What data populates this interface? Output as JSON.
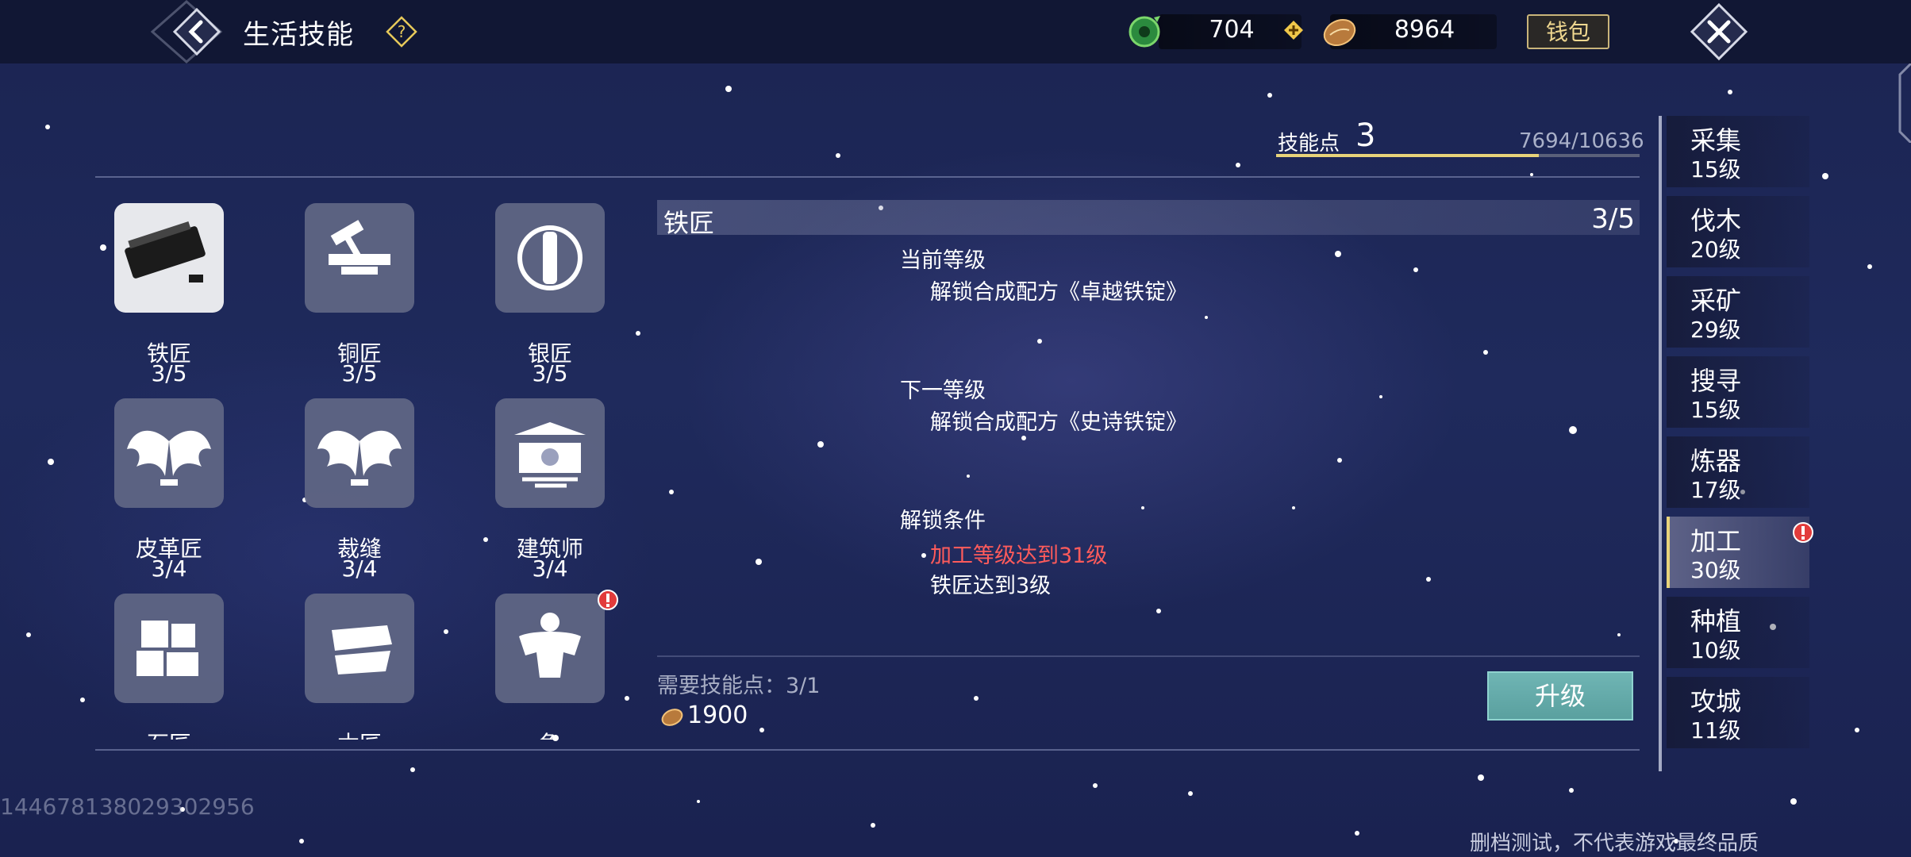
{
  "header": {
    "title": "生活技能",
    "help_icon": "question-diamond-icon",
    "resource1": {
      "icon": "jade-coin-icon",
      "value": "704"
    },
    "resource2": {
      "icon": "coin-pouch-icon",
      "value": "8964"
    },
    "wallet_label": "钱包"
  },
  "skill_points": {
    "label": "技能点",
    "value": "3",
    "progress_text": "7694/10636",
    "progress_fraction": 0.7234
  },
  "skills": [
    {
      "name": "铁匠",
      "level": "3/5",
      "icon": "iron-ingot-icon",
      "selected": true,
      "alert": false
    },
    {
      "name": "铜匠",
      "level": "3/5",
      "icon": "hammer-anvil-icon",
      "selected": false,
      "alert": false
    },
    {
      "name": "银匠",
      "level": "3/5",
      "icon": "silver-scroll-icon",
      "selected": false,
      "alert": false
    },
    {
      "name": "皮革匠",
      "level": "3/4",
      "icon": "wings-icon",
      "selected": false,
      "alert": false
    },
    {
      "name": "裁缝",
      "level": "3/4",
      "icon": "wings-icon",
      "selected": false,
      "alert": false
    },
    {
      "name": "建筑师",
      "level": "3/4",
      "icon": "pavilion-icon",
      "selected": false,
      "alert": false
    },
    {
      "name": "石匠",
      "level": "",
      "icon": "stone-blocks-icon",
      "selected": false,
      "alert": false
    },
    {
      "name": "木匠",
      "level": "",
      "icon": "wood-block-icon",
      "selected": false,
      "alert": false
    },
    {
      "name": "兔",
      "level": "",
      "icon": "muscle-figure-icon",
      "selected": false,
      "alert": true
    }
  ],
  "detail": {
    "title": "铁匠",
    "level": "3/5",
    "current_label": "当前等级",
    "current_text": "解锁合成配方《卓越铁锭》",
    "next_label": "下一等级",
    "next_text": "解锁合成配方《史诗铁锭》",
    "unlock_label": "解锁条件",
    "requirements": [
      {
        "text": "加工等级达到31级",
        "met": false
      },
      {
        "text": "铁匠达到3级",
        "met": true
      }
    ],
    "need_points_label": "需要技能点：3/1",
    "cost_icon": "coin-pouch-icon",
    "cost_value": "1900",
    "upgrade_label": "升级"
  },
  "tabs": [
    {
      "name": "采集",
      "level": "15级",
      "active": false,
      "alert": false
    },
    {
      "name": "伐木",
      "level": "20级",
      "active": false,
      "alert": false
    },
    {
      "name": "采矿",
      "level": "29级",
      "active": false,
      "alert": false
    },
    {
      "name": "搜寻",
      "level": "15级",
      "active": false,
      "alert": false
    },
    {
      "name": "炼器",
      "level": "17级",
      "active": false,
      "alert": false
    },
    {
      "name": "加工",
      "level": "30级",
      "active": true,
      "alert": true
    },
    {
      "name": "种植",
      "level": "10级",
      "active": false,
      "alert": false
    },
    {
      "name": "攻城",
      "level": "11级",
      "active": false,
      "alert": false
    }
  ],
  "footer": {
    "uid": "144678138029302956",
    "disclaimer": "删档测试，不代表游戏最终品质"
  },
  "colors": {
    "accent_gold": "#e8d37a",
    "requirement_unmet": "#ff5b5b",
    "upgrade_button": "#6fb5b4"
  }
}
